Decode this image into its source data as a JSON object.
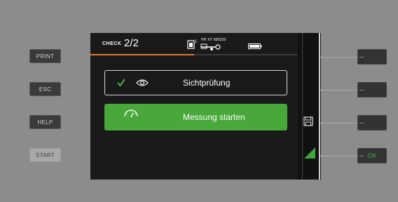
{
  "left_buttons": [
    {
      "label": "PRINT"
    },
    {
      "label": "ESC"
    },
    {
      "label": "HELP"
    },
    {
      "label": "START"
    }
  ],
  "header": {
    "check_label": "CHECK",
    "page_count": "2/2",
    "device_id": "HH XY 995333",
    "progress_fraction": 0.5,
    "accent_color": "#e8792e"
  },
  "options": [
    {
      "label": "Sichtprüfung",
      "icons": [
        "checkmark-icon",
        "eye-icon"
      ],
      "selected": false
    },
    {
      "label": "Messung starten",
      "icons": [
        "gauge-icon"
      ],
      "selected": true
    }
  ],
  "side_icons": [
    "save-icon",
    "start-triangle-icon"
  ],
  "right_buttons": [
    {
      "label": ""
    },
    {
      "label": ""
    },
    {
      "label": ""
    },
    {
      "label": "OK"
    }
  ],
  "colors": {
    "background": "#8c8c8c",
    "screen": "#1a1a1a",
    "selected": "#48a83a",
    "ok": "#3fae3f"
  }
}
